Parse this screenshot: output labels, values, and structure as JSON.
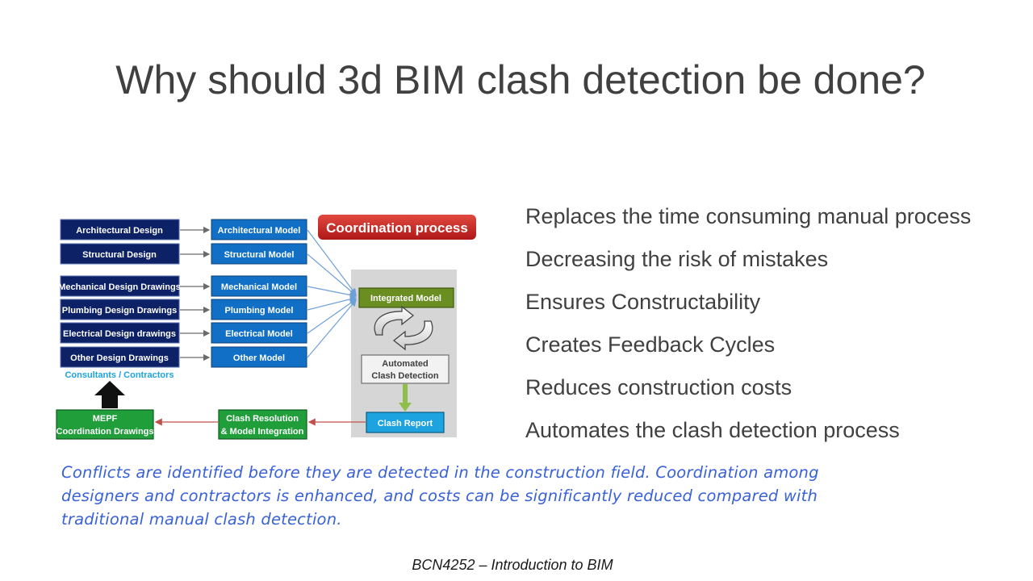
{
  "slide": {
    "title": "Why should 3d BIM clash detection be done?",
    "bullets": [
      "Replaces the time consuming manual process",
      "Decreasing the risk of mistakes",
      "Ensures Constructability",
      "Creates Feedback Cycles",
      "Reduces construction costs",
      "Automates the clash detection process"
    ],
    "note": "Conflicts are identified before they are detected in the construction field. Coordination among designers and contractors is enhanced, and costs can be significantly reduced compared with traditional manual clash detection.",
    "footer": "BCN4252 – Introduction to BIM"
  },
  "diagram": {
    "banner": "Coordination process",
    "designs": [
      "Architectural Design",
      "Structural Design",
      "Mechanical Design Drawings",
      "Plumbing Design  Drawings",
      "Electrical Design drawings",
      "Other Design Drawings"
    ],
    "models": [
      "Architectural Model",
      "Structural Model",
      "Mechanical Model",
      "Plumbing Model",
      "Electrical Model",
      "Other Model"
    ],
    "group_label": "Consultants / Contractors",
    "integrated_model": "Integrated Model",
    "automated_line1": "Automated",
    "automated_line2": "Clash Detection",
    "clash_report": "Clash Report",
    "resolution_line1": "Clash Resolution",
    "resolution_line2": "& Model Integration",
    "mepf_line1": "MEPF",
    "mepf_line2": "Coordination Drawings",
    "colors": {
      "navy": "#0d2167",
      "blue": "#1170c6",
      "green": "#1f9e3a",
      "olive": "#6b8e23",
      "red": "#c8201e",
      "cyan": "#1ca3e0"
    }
  }
}
